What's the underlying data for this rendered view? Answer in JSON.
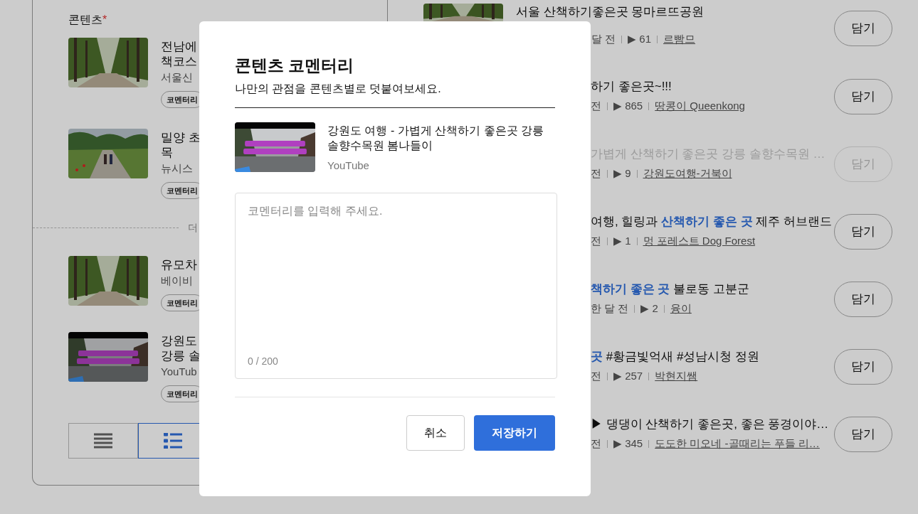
{
  "left_panel": {
    "heading": "콘텐츠",
    "required_mark": "*",
    "items": [
      {
        "title_lines": [
          "전남에",
          "책코스"
        ],
        "source": "서울신",
        "chip": "코멘터리"
      },
      {
        "title_lines": [
          "밀양 초",
          "목"
        ],
        "source": "뉴시스",
        "chip": "코멘터리"
      },
      {
        "title_lines": [
          "유모차"
        ],
        "source": "베이비",
        "chip": "코멘터리"
      },
      {
        "title_lines": [
          "강원도",
          "강릉 솔"
        ],
        "source": "YouTub",
        "chip": "코멘터리"
      }
    ],
    "more_label": "더",
    "view_toggle": [
      {
        "kind": "lines",
        "selected": false
      },
      {
        "kind": "list",
        "selected": true
      }
    ]
  },
  "right_list": [
    {
      "kind": "full",
      "title": "서울 산책하기좋은곳 몽마르뜨공원",
      "date": "달 전",
      "views": "▶ 61",
      "channel": "르빰므",
      "disabled": false,
      "button": "담기"
    },
    {
      "kind": "partial",
      "title": "하기 좋은곳~!!!",
      "date": "전",
      "views": "▶ 865",
      "channel": "땅콩이 Queenkong",
      "disabled": false,
      "button": "담기"
    },
    {
      "kind": "partial",
      "title": "가볍게 산책하기 좋은곳 강릉 솔향수목원 …",
      "date": "전",
      "views": "▶ 9",
      "channel": "강원도여행-거북이",
      "disabled": true,
      "button": "담기"
    },
    {
      "kind": "partial",
      "title": "여행, 힐링과 **산책하기 좋은 곳** 제주 허브랜드",
      "date": "전",
      "views": "▶ 1",
      "channel": "멍 포레스트 Dog Forest",
      "disabled": false,
      "button": "담기"
    },
    {
      "kind": "partial",
      "title": "**책하기 좋은 곳** 불로동 고분군",
      "date": "한 달 전",
      "views": "▶ 2",
      "channel": "융이",
      "disabled": false,
      "button": "담기"
    },
    {
      "kind": "partial",
      "title": "**곳** #황금빛억새 #성남시청 정원",
      "date": "전",
      "views": "▶ 257",
      "channel": "박현지쌤",
      "disabled": false,
      "button": "담기"
    },
    {
      "kind": "partial",
      "title": "▶ 댕댕이 산책하기 좋은곳, 좋은 풍경이야…",
      "date": "전",
      "views": "▶ 345",
      "channel": "도도한 미오네 -골때리는 푸들 리…",
      "disabled": false,
      "button": "담기"
    }
  ],
  "modal": {
    "title": "콘텐츠 코멘터리",
    "subtitle": "나만의 관점을 콘텐츠별로 덧붙여보세요.",
    "item": {
      "title": "강원도 여행 - 가볍게 산책하기 좋은곳 강릉 솔향수목원 봄나들이",
      "source": "YouTube"
    },
    "comment": {
      "placeholder": "코멘터리를 입력해 주세요.",
      "counter": "0 / 200"
    },
    "buttons": [
      {
        "label": "취소",
        "kind": "secondary"
      },
      {
        "label": "저장하기",
        "kind": "primary"
      }
    ]
  }
}
